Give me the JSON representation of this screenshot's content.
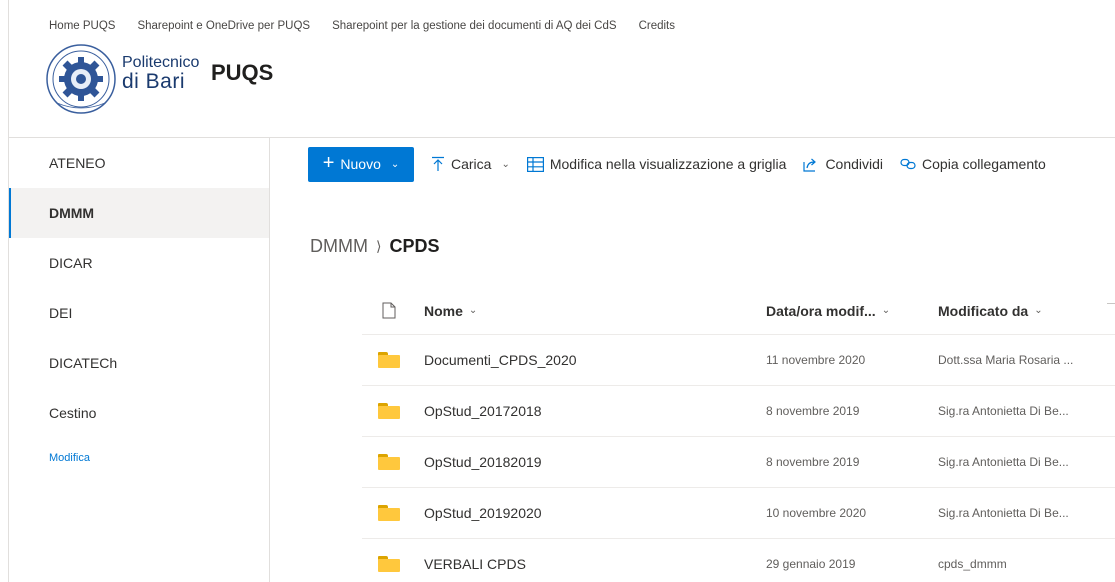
{
  "topnav": {
    "items": [
      "Home PUQS",
      "Sharepoint e OneDrive per PUQS",
      "Sharepoint per la gestione dei documenti di AQ dei CdS",
      "Credits"
    ]
  },
  "logo": {
    "line1": "Politecnico",
    "line2": "di Bari",
    "seal_text": "POLITECNICO DI BARI"
  },
  "site": {
    "title": "PUQS"
  },
  "sidebar": {
    "items": [
      {
        "label": "ATENEO",
        "selected": false
      },
      {
        "label": "DMMM",
        "selected": true
      },
      {
        "label": "DICAR",
        "selected": false
      },
      {
        "label": "DEI",
        "selected": false
      },
      {
        "label": "DICATECh",
        "selected": false
      },
      {
        "label": "Cestino",
        "selected": false
      }
    ],
    "edit_label": "Modifica"
  },
  "commandbar": {
    "new_label": "Nuovo",
    "upload_label": "Carica",
    "grid_label": "Modifica nella visualizzazione a griglia",
    "share_label": "Condividi",
    "copylink_label": "Copia collegamento"
  },
  "breadcrumb": {
    "parent": "DMMM",
    "current": "CPDS"
  },
  "list": {
    "headers": {
      "name": "Nome",
      "modified": "Data/ora modif...",
      "modified_by": "Modificato da"
    },
    "rows": [
      {
        "name": "Documenti_CPDS_2020",
        "modified": "11 novembre 2020",
        "modified_by": "Dott.ssa Maria Rosaria ..."
      },
      {
        "name": "OpStud_20172018",
        "modified": "8 novembre 2019",
        "modified_by": "Sig.ra Antonietta Di Be..."
      },
      {
        "name": "OpStud_20182019",
        "modified": "8 novembre 2019",
        "modified_by": "Sig.ra Antonietta Di Be..."
      },
      {
        "name": "OpStud_20192020",
        "modified": "10 novembre 2020",
        "modified_by": "Sig.ra Antonietta Di Be..."
      },
      {
        "name": "VERBALI CPDS",
        "modified": "29 gennaio 2019",
        "modified_by": "cpds_dmmm"
      }
    ]
  },
  "colors": {
    "accent": "#0078d4",
    "folder": "#ffc83d",
    "logo_blue": "#1a3a6e"
  }
}
